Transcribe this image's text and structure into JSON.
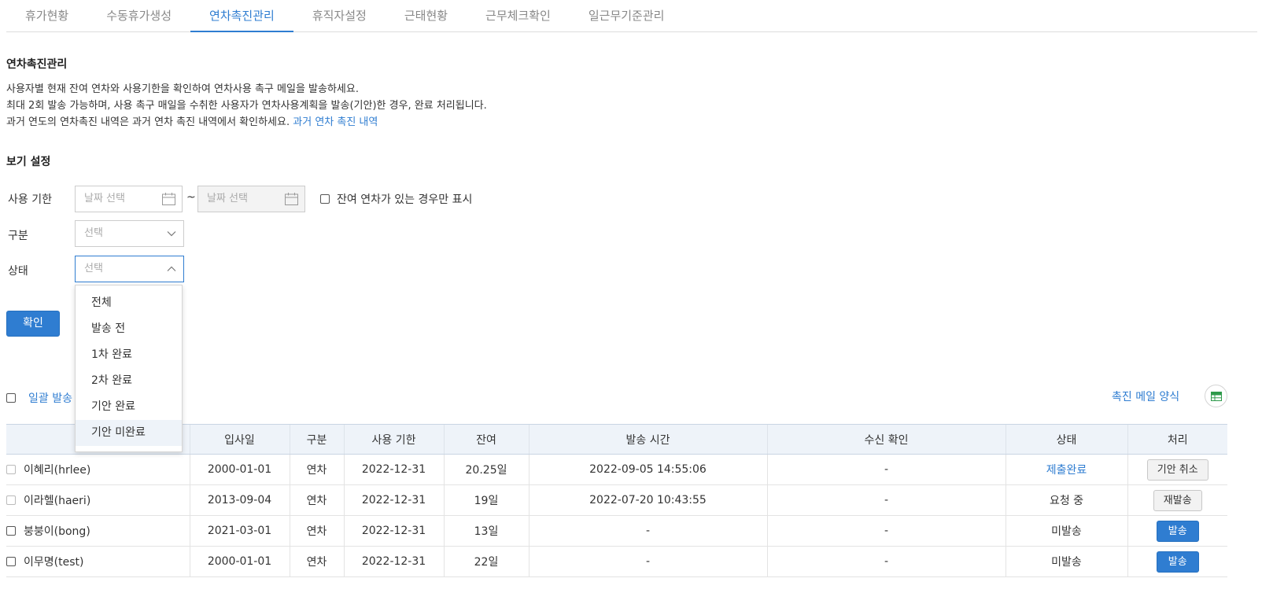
{
  "tabs": [
    {
      "label": "휴가현황",
      "active": false
    },
    {
      "label": "수동휴가생성",
      "active": false
    },
    {
      "label": "연차촉진관리",
      "active": true
    },
    {
      "label": "휴직자설정",
      "active": false
    },
    {
      "label": "근태현황",
      "active": false
    },
    {
      "label": "근무체크확인",
      "active": false
    },
    {
      "label": "일근무기준관리",
      "active": false
    }
  ],
  "page": {
    "title": "연차촉진관리",
    "desc_line1": "사용자별 현재 잔여 연차와 사용기한을 확인하여 연차사용 촉구 메일을 발송하세요.",
    "desc_line2": "최대 2회 발송 가능하며, 사용 촉구 매일을 수취한 사용자가 연차사용계획을 발송(기안)한 경우, 완료 처리됩니다.",
    "desc_line3": "과거 연도의 연차촉진 내역은 과거 연차 촉진 내역에서 확인하세요.",
    "desc_link": "과거 연차 촉진 내역"
  },
  "view_settings": {
    "title": "보기 설정",
    "usage_period_label": "사용 기한",
    "date_placeholder_start": "날짜 선택",
    "date_placeholder_end": "날짜 선택",
    "tilde": "~",
    "remaining_only_label": "잔여 연차가 있는 경우만 표시",
    "category_label": "구분",
    "category_placeholder": "선택",
    "status_label": "상태",
    "status_placeholder": "선택",
    "confirm_label": "확인"
  },
  "status_dropdown": {
    "options": [
      "전체",
      "발송 전",
      "1차 완료",
      "2차 완료",
      "기안 완료",
      "기안 미완료"
    ],
    "hover_index": 5
  },
  "toolbar": {
    "bulk_send_label": "일괄 발송",
    "mail_template_label": "촉진 메일 양식",
    "excel_icon": "spreadsheet-icon"
  },
  "table": {
    "headers": [
      "",
      "입사일",
      "구분",
      "사용 기한",
      "잔여",
      "발송 시간",
      "수신 확인",
      "상태",
      "처리"
    ],
    "rows": [
      {
        "name": "이혜리(hrlee)",
        "join": "2000-01-01",
        "type": "연차",
        "deadline": "2022-12-31",
        "remain": "20.25일",
        "sent": "2022-09-05 14:55:06",
        "received": "-",
        "status": "제출완료",
        "status_link": true,
        "action": "기안 취소",
        "action_style": "gray",
        "check_disabled": true
      },
      {
        "name": "이라헬(haeri)",
        "join": "2013-09-04",
        "type": "연차",
        "deadline": "2022-12-31",
        "remain": "19일",
        "sent": "2022-07-20 10:43:55",
        "received": "-",
        "status": "요청 중",
        "status_link": false,
        "action": "재발송",
        "action_style": "gray",
        "check_disabled": true
      },
      {
        "name": "붕붕이(bong)",
        "join": "2021-03-01",
        "type": "연차",
        "deadline": "2022-12-31",
        "remain": "13일",
        "sent": "-",
        "received": "-",
        "status": "미발송",
        "status_link": false,
        "action": "발송",
        "action_style": "blue",
        "check_disabled": false
      },
      {
        "name": "이무명(test)",
        "join": "2000-01-01",
        "type": "연차",
        "deadline": "2022-12-31",
        "remain": "22일",
        "sent": "-",
        "received": "-",
        "status": "미발송",
        "status_link": false,
        "action": "발송",
        "action_style": "blue",
        "check_disabled": false
      }
    ]
  },
  "colors": {
    "accent": "#2f7dd1",
    "header_bg": "#eef3f9",
    "excel_green": "#2e9a4b"
  }
}
